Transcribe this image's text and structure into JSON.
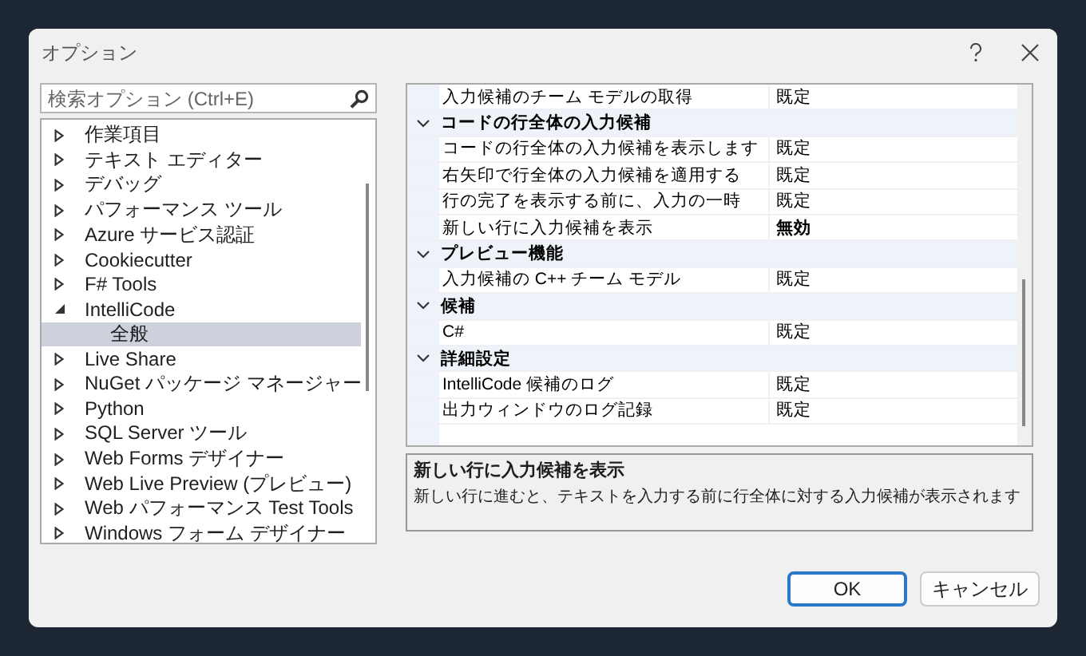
{
  "window": {
    "title": "オプション"
  },
  "search": {
    "placeholder": "検索オプション (Ctrl+E)"
  },
  "tree": [
    {
      "label": "作業項目",
      "expanded": false,
      "selected": false
    },
    {
      "label": "テキスト エディター",
      "expanded": false,
      "selected": false
    },
    {
      "label": "デバッグ",
      "expanded": false,
      "selected": false
    },
    {
      "label": "パフォーマンス ツール",
      "expanded": false,
      "selected": false
    },
    {
      "label": "Azure サービス認証",
      "expanded": false,
      "selected": false
    },
    {
      "label": "Cookiecutter",
      "expanded": false,
      "selected": false
    },
    {
      "label": "F# Tools",
      "expanded": false,
      "selected": false
    },
    {
      "label": "IntelliCode",
      "expanded": true,
      "selected": false,
      "children": [
        {
          "label": "全般",
          "selected": true
        }
      ]
    },
    {
      "label": "Live Share",
      "expanded": false,
      "selected": false
    },
    {
      "label": "NuGet パッケージ マネージャー",
      "expanded": false,
      "selected": false
    },
    {
      "label": "Python",
      "expanded": false,
      "selected": false
    },
    {
      "label": "SQL Server ツール",
      "expanded": false,
      "selected": false
    },
    {
      "label": "Web Forms デザイナー",
      "expanded": false,
      "selected": false
    },
    {
      "label": "Web Live Preview (プレビュー)",
      "expanded": false,
      "selected": false
    },
    {
      "label": "Web パフォーマンス Test Tools",
      "expanded": false,
      "selected": false
    },
    {
      "label": "Windows フォーム デザイナー",
      "expanded": false,
      "selected": false
    }
  ],
  "property_grid": [
    {
      "kind": "property",
      "name": "入力候補のチーム モデルの取得",
      "value": "既定",
      "modified": false
    },
    {
      "kind": "category",
      "name": "コードの行全体の入力候補",
      "expanded": true,
      "children": [
        {
          "kind": "property",
          "name": "コードの行全体の入力候補を表示します",
          "value": "既定",
          "modified": false
        },
        {
          "kind": "property",
          "name": "右矢印で行全体の入力候補を適用する",
          "value": "既定",
          "modified": false
        },
        {
          "kind": "property",
          "name": "行の完了を表示する前に、入力の一時",
          "value": "既定",
          "modified": false
        },
        {
          "kind": "property",
          "name": "新しい行に入力候補を表示",
          "value": "無効",
          "modified": true
        }
      ]
    },
    {
      "kind": "category",
      "name": "プレビュー機能",
      "expanded": true,
      "children": [
        {
          "kind": "property",
          "name": "入力候補の C++ チーム モデル",
          "value": "既定",
          "modified": false
        }
      ]
    },
    {
      "kind": "category",
      "name": "候補",
      "expanded": true,
      "children": [
        {
          "kind": "property",
          "name": "C#",
          "value": "既定",
          "modified": false
        }
      ]
    },
    {
      "kind": "category",
      "name": "詳細設定",
      "expanded": true,
      "children": [
        {
          "kind": "property",
          "name": "IntelliCode 候補のログ",
          "value": "既定",
          "modified": false
        },
        {
          "kind": "property",
          "name": "出力ウィンドウのログ記録",
          "value": "既定",
          "modified": false
        }
      ]
    }
  ],
  "description": {
    "title": "新しい行に入力候補を表示",
    "text": "新しい行に進むと、テキストを入力する前に行全体に対する入力候補が表示されます"
  },
  "buttons": [
    {
      "label": "OK",
      "default": true
    },
    {
      "label": "キャンセル",
      "default": false
    }
  ]
}
